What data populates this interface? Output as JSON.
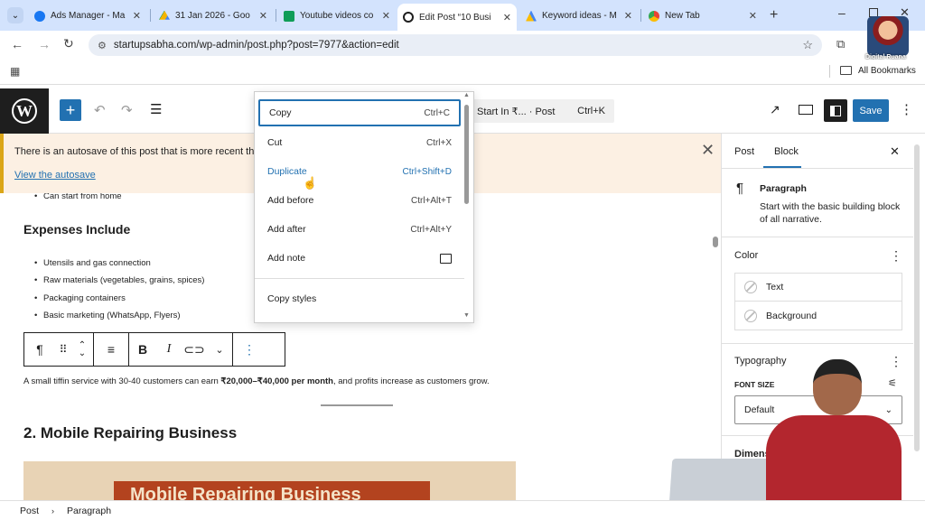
{
  "browser": {
    "tabs": [
      {
        "title": "Ads Manager - Ma",
        "icon": "meta-icon",
        "color": "#1877f2"
      },
      {
        "title": "31 Jan 2026 - Goo",
        "icon": "drive-icon",
        "color": "#f4b400"
      },
      {
        "title": "Youtube videos co",
        "icon": "sheets-icon",
        "color": "#0f9d58"
      },
      {
        "title": "Edit Post “10 Busi",
        "icon": "wordpress-icon",
        "color": "#1e1e1e"
      },
      {
        "title": "Keyword ideas - M",
        "icon": "google-ads-icon",
        "color": "#4285f4"
      },
      {
        "title": "New Tab",
        "icon": "chrome-icon",
        "color": "#ea4335"
      }
    ],
    "url": "startupsabha.com/wp-admin/post.php?post=7977&action=edit",
    "bookmarks_label": "All Bookmarks"
  },
  "wp": {
    "command_text": "Start In ₹...  · Post",
    "command_shortcut": "Ctrl+K",
    "save_label": "Save"
  },
  "notice": {
    "message": "There is an autosave of this post that is more recent than t",
    "link": "View the autosave"
  },
  "content": {
    "cutoff_item": "Can start from home",
    "heading1": "Expenses Include",
    "expenses": [
      "Utensils and gas connection",
      "Raw materials (vegetables, grains, spices)",
      "Packaging containers",
      "Basic marketing (WhatsApp, Flyers)"
    ],
    "paragraph_pre": "A small tiffin service with 30-40 customers can earn ",
    "paragraph_bold": "₹20,000–₹40,000 per month",
    "paragraph_post": ", and profits increase as customers grow.",
    "heading2": "2. Mobile Repairing Business",
    "image_text": "Mobile Repairing Business"
  },
  "menu": {
    "items": [
      {
        "label": "Copy",
        "shortcut": "Ctrl+C"
      },
      {
        "label": "Cut",
        "shortcut": "Ctrl+X"
      },
      {
        "label": "Duplicate",
        "shortcut": "Ctrl+Shift+D"
      },
      {
        "label": "Add before",
        "shortcut": "Ctrl+Alt+T"
      },
      {
        "label": "Add after",
        "shortcut": "Ctrl+Alt+Y"
      },
      {
        "label": "Add note",
        "shortcut": ""
      }
    ],
    "copy_styles": "Copy styles"
  },
  "sidebar": {
    "tab_post": "Post",
    "tab_block": "Block",
    "block_title": "Paragraph",
    "block_desc": "Start with the basic building block of all narrative.",
    "color_title": "Color",
    "color_text": "Text",
    "color_background": "Background",
    "typography_title": "Typography",
    "font_size_label": "FONT SIZE",
    "font_size_value": "Default",
    "dimensions_title": "Dimensi"
  },
  "statusbar": {
    "crumb1": "Post",
    "crumb2": "Paragraph"
  },
  "watermark": "Digital Ruana"
}
